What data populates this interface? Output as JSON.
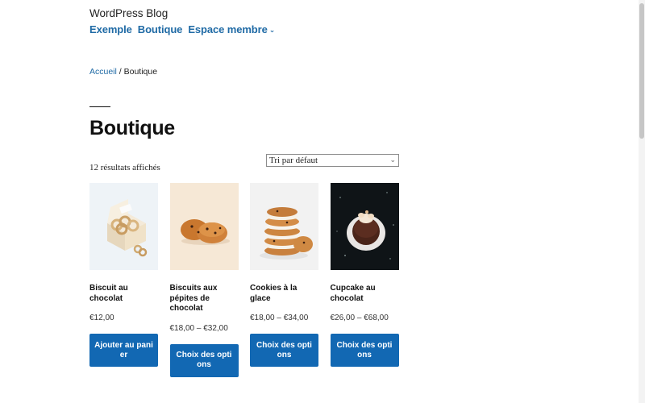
{
  "site": {
    "title": "WordPress Blog"
  },
  "nav": {
    "items": [
      "Exemple",
      "Boutique",
      "Espace membre"
    ]
  },
  "breadcrumb": {
    "home": "Accueil",
    "separator": " / ",
    "current": "Boutique"
  },
  "page": {
    "title": "Boutique"
  },
  "shop": {
    "result_count": "12 résultats affichés",
    "orderby": {
      "selected": "Tri par défaut"
    },
    "products": [
      {
        "name": "Biscuit au chocolat",
        "price": "€12,00",
        "button": "Ajouter au panier"
      },
      {
        "name": "Biscuits aux pépites de chocolat",
        "price": "€18,00 – €32,00",
        "button": "Choix des options"
      },
      {
        "name": "Cookies à la glace",
        "price": "€18,00 – €34,00",
        "button": "Choix des options"
      },
      {
        "name": "Cupcake au chocolat",
        "price": "€26,00 – €68,00",
        "button": "Choix des options"
      }
    ]
  },
  "colors": {
    "link": "#1f6aa5",
    "button": "#1268b3"
  },
  "icons": {
    "nav_submenu": "chevron-down-icon",
    "select": "chevron-down-icon"
  }
}
